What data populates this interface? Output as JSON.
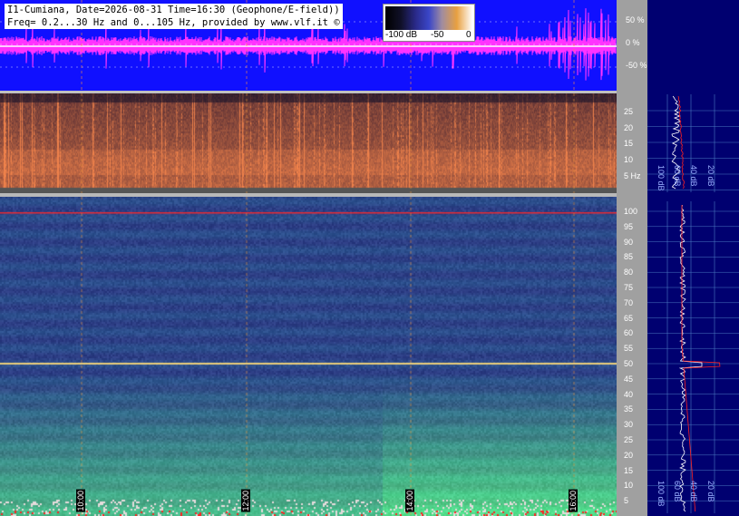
{
  "header": {
    "line1": "I1-Cumiana, Date=2026-08-31 Time=16:30 (Geophone/E-field))",
    "line2": "Freq= 0.2...30 Hz and 0...105 Hz, provided by www.vlf.it ©"
  },
  "colorbar": {
    "min_label": "-100 dB",
    "mid_label": "-50",
    "max_label": "0"
  },
  "waveform_axis": {
    "ticks": [
      "50 %",
      "0 %",
      "-50 %"
    ]
  },
  "low_band_axis": {
    "ticks": [
      "25",
      "20",
      "15",
      "10",
      "5 Hz"
    ]
  },
  "high_band_axis": {
    "ticks": [
      "100",
      "95",
      "90",
      "85",
      "80",
      "75",
      "70",
      "65",
      "60",
      "55",
      "50",
      "45",
      "40",
      "35",
      "30",
      "25",
      "20",
      "15",
      "10",
      "5"
    ]
  },
  "time_labels": [
    "10:00",
    "12:00",
    "14:00",
    "16:00"
  ],
  "profile_low_labels": [
    "100 dB",
    "60 dB",
    "40 dB",
    "20 dB"
  ],
  "profile_high_labels": [
    "100 dB",
    "60 dB",
    "40 dB",
    "20 dB"
  ],
  "colors": {
    "background_blue": "#1010ff",
    "waveform_magenta": "#ff33ff",
    "low_spectrum_base": "#2a1c3c",
    "high_spectrum_base": "#2b3a8a",
    "right_panel": "#000070",
    "marker_red": "#ff2020"
  }
}
